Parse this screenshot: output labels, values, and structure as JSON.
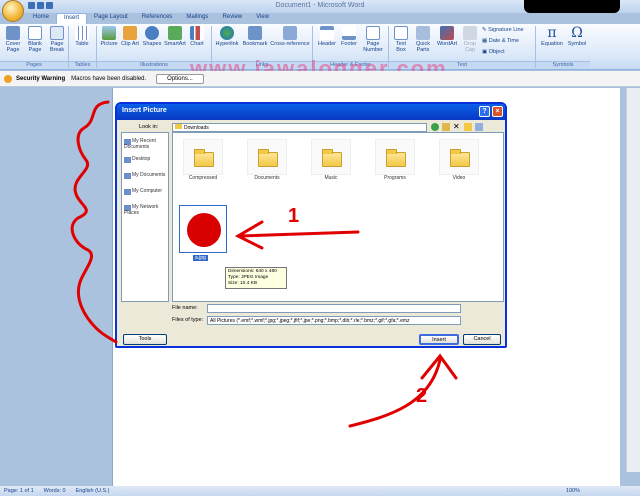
{
  "window": {
    "title": "Document1 - Microsoft Word"
  },
  "tabs": [
    "Home",
    "Insert",
    "Page Layout",
    "References",
    "Mailings",
    "Review",
    "View"
  ],
  "ribbon": {
    "pages": [
      "Cover Page",
      "Blank Page",
      "Page Break"
    ],
    "tables": [
      "Table"
    ],
    "illustrations": [
      "Picture",
      "Clip Art",
      "Shapes",
      "SmartArt",
      "Chart"
    ],
    "links": [
      "Hyperlink",
      "Bookmark",
      "Cross-reference"
    ],
    "header_footer": [
      "Header",
      "Footer",
      "Page Number"
    ],
    "text": [
      "Text Box",
      "Quick Parts",
      "WordArt",
      "Drop Cap"
    ],
    "text_small": [
      "Signature Line",
      "Date & Time",
      "Object"
    ],
    "symbols": [
      "Equation",
      "Symbol"
    ],
    "groups": [
      "Pages",
      "Tables",
      "Illustrations",
      "Links",
      "Header & Footer",
      "Text",
      "Symbols"
    ]
  },
  "security": {
    "label": "Security Warning",
    "message": "Macros have been disabled.",
    "options": "Options..."
  },
  "watermark": "www.jawalogger.com",
  "dialog": {
    "title": "Insert Picture",
    "look_in_label": "Look in:",
    "look_in_value": "Downloads",
    "places": [
      "My Recent Documents",
      "Desktop",
      "My Documents",
      "My Computer",
      "My Network Places"
    ],
    "folders": [
      "Compressed",
      "Documents",
      "Music",
      "Programs",
      "Video"
    ],
    "file": {
      "name": "a.jpg",
      "tooltip": [
        "Dimensions: 640 x 480",
        "Type: JPEG Image",
        "Size: 10.4 KB"
      ]
    },
    "file_name_label": "File name:",
    "file_name_value": "",
    "files_type_label": "Files of type:",
    "files_type_value": "All Pictures (*.emf;*.wmf;*.jpg;*.jpeg;*.jfif;*.jpe;*.png;*.bmp;*.dib;*.rle;*.bmz;*.gif;*.gfa;*.emz",
    "tools": "Tools",
    "insert": "Insert",
    "cancel": "Cancel"
  },
  "annotations": {
    "one": "1",
    "two": "2"
  },
  "status": {
    "page": "Page: 1 of 1",
    "words": "Words: 0",
    "lang": "English (U.S.)",
    "zoom": "100%"
  },
  "colors": {
    "accent": "#15428b",
    "annotation": "#e00000"
  }
}
